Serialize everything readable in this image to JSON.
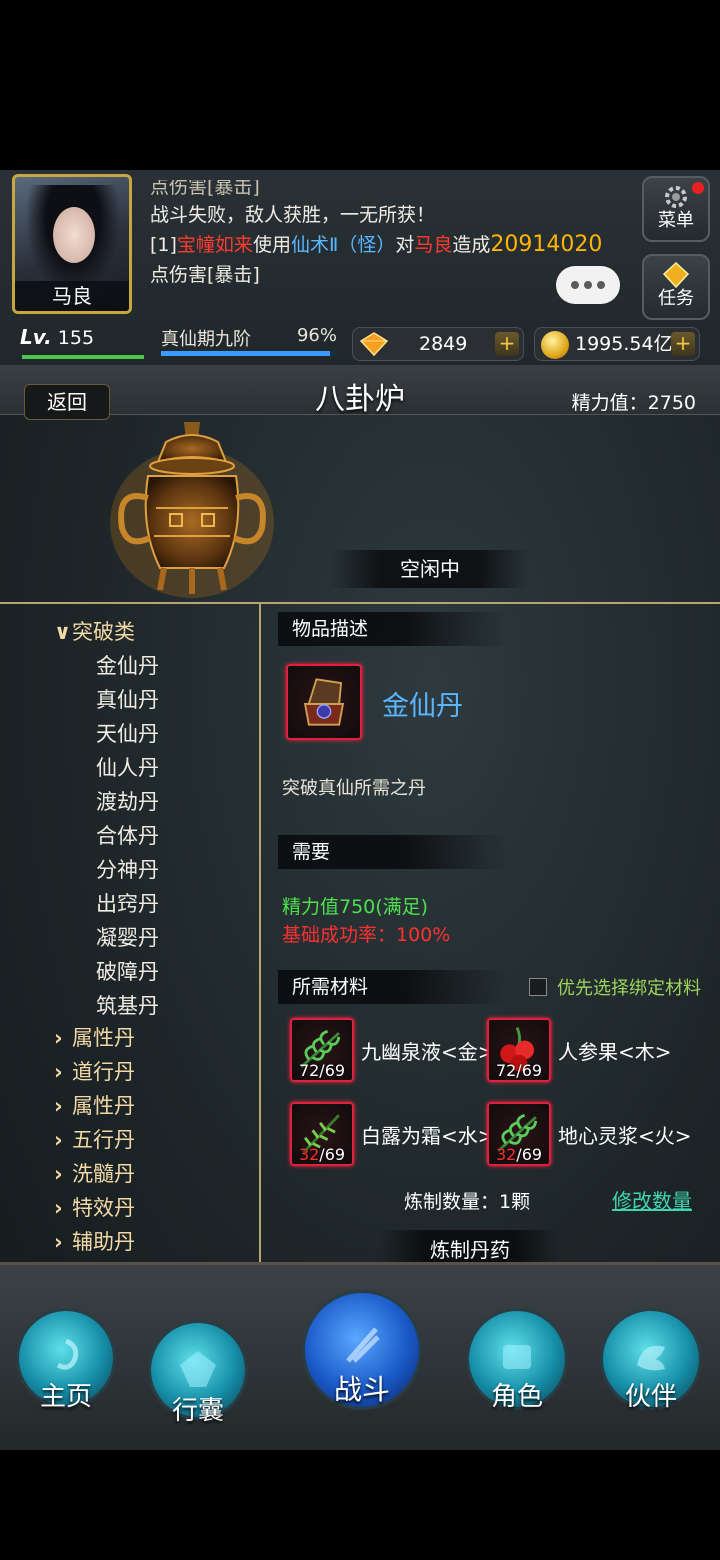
{
  "player": {
    "name": "马良",
    "level_label": "Lv.",
    "level": "155",
    "realm": "真仙期九阶",
    "realm_progress": "96%",
    "realm_progress_value": 0.96,
    "gems": "2849",
    "gold": "1995.54亿"
  },
  "battle_log": {
    "cut_line": "点伤害[暴击]",
    "line1": "战斗失败，敌人获胜，一无所获！",
    "line2_prefix": "[1]",
    "line2_enemy": "宝幢如来",
    "line2_use": "使用",
    "line2_skill": "仙术Ⅱ（怪）",
    "line2_to": "对",
    "line2_target": "马良",
    "line2_cause": "造成",
    "line2_damage": "20914020",
    "line3": "点伤害[暴击]"
  },
  "side_buttons": {
    "menu": "菜单",
    "task": "任务"
  },
  "furnace": {
    "back": "返回",
    "title": "八卦炉",
    "energy": "精力值：2750",
    "status": "空闲中"
  },
  "left_list": {
    "open_category": "突破类",
    "items": [
      "金仙丹",
      "真仙丹",
      "天仙丹",
      "仙人丹",
      "渡劫丹",
      "合体丹",
      "分神丹",
      "出窍丹",
      "凝婴丹",
      "破障丹",
      "筑基丹"
    ],
    "categories": [
      "属性丹",
      "道行丹",
      "属性丹",
      "五行丹",
      "洗髓丹",
      "特效丹",
      "辅助丹"
    ]
  },
  "detail": {
    "desc_header": "物品描述",
    "item_name": "金仙丹",
    "item_desc": "突破真仙所需之丹",
    "need_header": "需要",
    "need_energy": "精力值750(满足)",
    "need_rate": "基础成功率：100%",
    "materials_header": "所需材料",
    "bind_option": "优先选择绑定材料",
    "materials": [
      {
        "name": "九幽泉液<金>",
        "have": "72",
        "need": "/69",
        "icon": "green-herb-icon"
      },
      {
        "name": "人参果<木>",
        "have": "72",
        "need": "/69",
        "icon": "red-fruit-icon"
      },
      {
        "name": "白露为霜<水>",
        "have": "32",
        "need": "/69",
        "icon": "green-sprig-icon"
      },
      {
        "name": "地心灵浆<火>",
        "have": "32",
        "need": "/69",
        "icon": "green-herb-icon"
      }
    ],
    "craft_count": "炼制数量：1颗",
    "modify": "修改数量",
    "craft_button": "炼制丹药"
  },
  "nav": {
    "home": "主页",
    "bag": "行囊",
    "battle": "战斗",
    "role": "角色",
    "partner": "伙伴"
  },
  "colors": {
    "accent_gold": "#c7a540",
    "item_blue": "#5ab6ff",
    "satisfied_green": "#4ee14e",
    "fail_red": "#ff3030",
    "link_teal": "#3fd6b0"
  }
}
